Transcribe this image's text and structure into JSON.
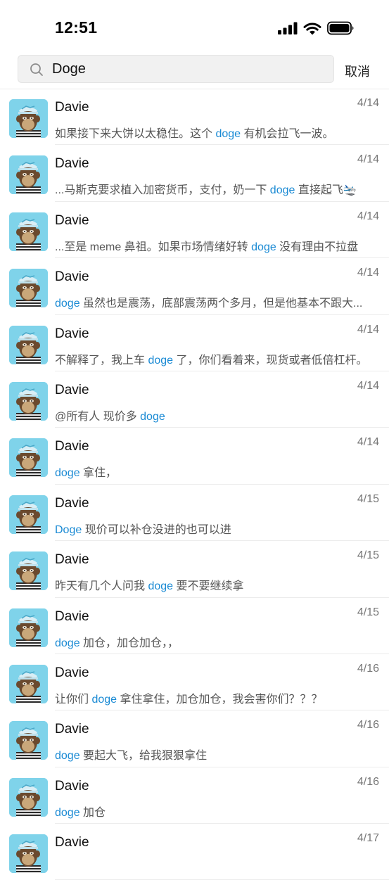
{
  "status_bar": {
    "time": "12:51"
  },
  "search": {
    "query": "Doge",
    "cancel_label": "取消"
  },
  "colors": {
    "highlight": "#1a8ad4",
    "avatar_bg": "#7fd3ea"
  },
  "results": [
    {
      "name": "Davie",
      "date": "4/14",
      "pre": "如果接下来大饼以太稳住。这个 ",
      "match": "doge",
      "post": " 有机会拉飞一波。"
    },
    {
      "name": "Davie",
      "date": "4/14",
      "pre": "...马斯克要求植入加密货币，支付，奶一下 ",
      "match": "doge",
      "post": " 直接起飞🛬"
    },
    {
      "name": "Davie",
      "date": "4/14",
      "pre": "...至是 meme 鼻祖。如果市场情绪好转 ",
      "match": "doge",
      "post": " 没有理由不拉盘"
    },
    {
      "name": "Davie",
      "date": "4/14",
      "pre": "",
      "match": "doge",
      "post": " 虽然也是震荡，底部震荡两个多月，但是他基本不跟大..."
    },
    {
      "name": "Davie",
      "date": "4/14",
      "pre": "不解释了，我上车 ",
      "match": "doge",
      "post": " 了，你们看着来，现货或者低倍杠杆。"
    },
    {
      "name": "Davie",
      "date": "4/14",
      "pre": "@所有人 现价多 ",
      "match": "doge",
      "post": ""
    },
    {
      "name": "Davie",
      "date": "4/14",
      "pre": "",
      "match": "doge",
      "post": " 拿住，"
    },
    {
      "name": "Davie",
      "date": "4/15",
      "pre": "",
      "match": "Doge",
      "post": " 现价可以补仓没进的也可以进"
    },
    {
      "name": "Davie",
      "date": "4/15",
      "pre": "昨天有几个人问我 ",
      "match": "doge",
      "post": " 要不要继续拿"
    },
    {
      "name": "Davie",
      "date": "4/15",
      "pre": "",
      "match": "doge",
      "post": " 加仓，加仓加仓，，"
    },
    {
      "name": "Davie",
      "date": "4/16",
      "pre": "让你们 ",
      "match": "doge",
      "post": " 拿住拿住，加仓加仓，我会害你们？？？"
    },
    {
      "name": "Davie",
      "date": "4/16",
      "pre": "",
      "match": "doge",
      "post": " 要起大飞，给我狠狠拿住"
    },
    {
      "name": "Davie",
      "date": "4/16",
      "pre": "",
      "match": "doge",
      "post": " 加仓"
    },
    {
      "name": "Davie",
      "date": "4/17",
      "pre": "",
      "match": "",
      "post": ""
    }
  ]
}
